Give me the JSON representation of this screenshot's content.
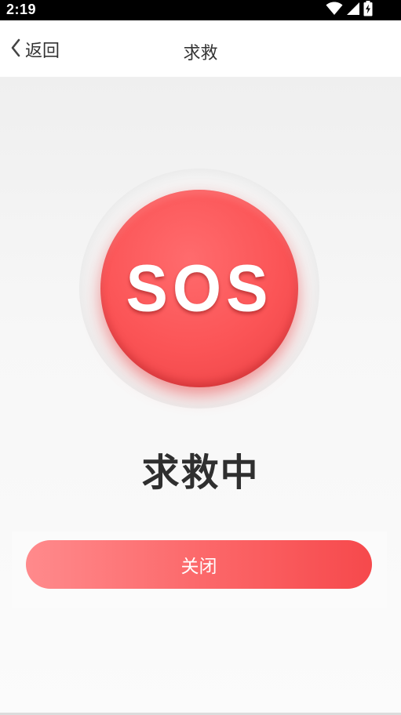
{
  "status_bar": {
    "time": "2:19",
    "icons": [
      "wifi-icon",
      "cellular-signal-icon",
      "battery-charging-icon"
    ]
  },
  "nav": {
    "back_label": "返回",
    "title": "求救"
  },
  "sos": {
    "button_label": "SOS",
    "status_text": "求救中",
    "accent_color": "#fb5456"
  },
  "actions": {
    "close_label": "关闭",
    "gradient_start": "#ff8a8c",
    "gradient_end": "#f6494c"
  }
}
